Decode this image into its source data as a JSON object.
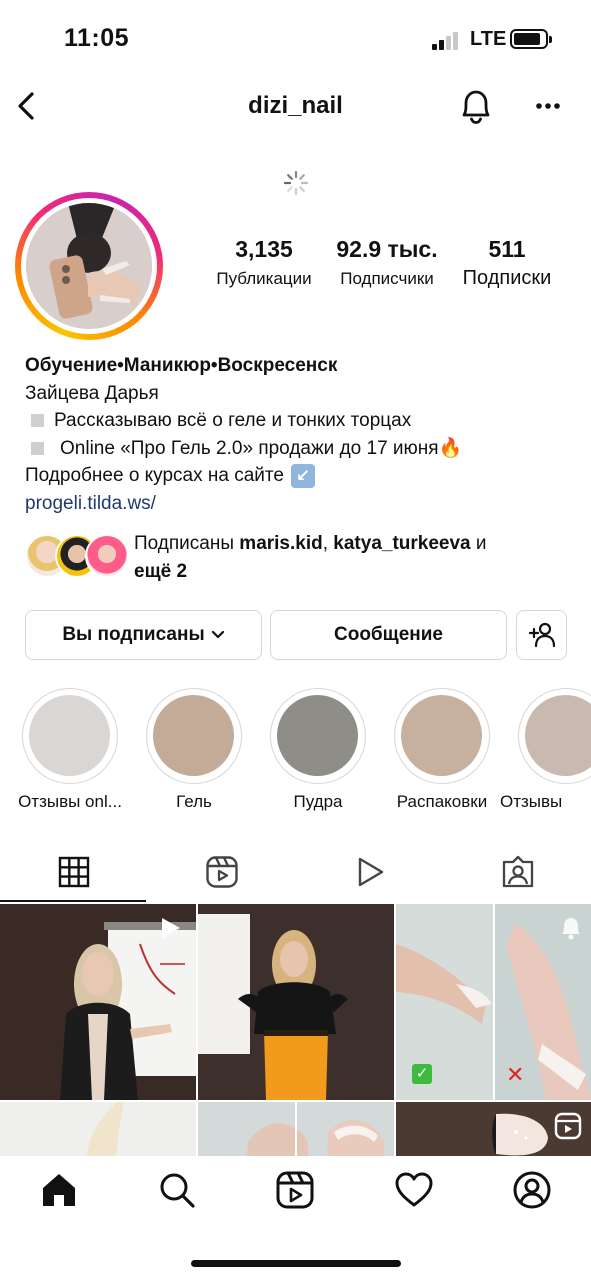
{
  "status_bar": {
    "time": "11:05",
    "network": "LTE",
    "signal_bars_active": 2,
    "signal_bars_total": 4
  },
  "header": {
    "username": "dizi_nail",
    "back_icon": "chevron-left-icon",
    "bell_icon": "bell-icon",
    "more_icon": "more-horizontal-icon"
  },
  "stats": {
    "posts": {
      "value": "3,135",
      "label": "Публикации"
    },
    "followers": {
      "value": "92.9 тыс.",
      "label": "Подписчики"
    },
    "following": {
      "value": "511",
      "label": "Подписки"
    }
  },
  "bio": {
    "name": "Обучение•Маникюр•Воскресенск",
    "line1": "Зайцева Дарья",
    "line2": "Рассказываю всё о геле и тонких торцах",
    "line3": "Online «Про Гель 2.0» продажи до 17 июня",
    "line3_emoji": "🔥",
    "line4": "Подробнее о курсах на сайте",
    "line4_emoji": "↙️",
    "link": "progeli.tilda.ws/"
  },
  "followed_by": {
    "prefix": "Подписаны ",
    "user1": "maris.kid",
    "sep": ", ",
    "user2": "katya_turkeeva",
    "and": " и ",
    "more": "ещё 2"
  },
  "buttons": {
    "following": "Вы подписаны",
    "message": "Сообщение",
    "add_icon": "add-person-icon"
  },
  "highlights": [
    {
      "label": "Отзывы onl...",
      "color": "#d9d6d4"
    },
    {
      "label": "Гель",
      "color": "#c3ab98"
    },
    {
      "label": "Пудра",
      "color": "#8f8d87"
    },
    {
      "label": "Распаковки",
      "color": "#c8b09e"
    },
    {
      "label": "Отзывы",
      "color": "#c8bab0"
    }
  ],
  "tabs": [
    {
      "name": "grid-icon",
      "active": true
    },
    {
      "name": "reels-icon",
      "active": false
    },
    {
      "name": "play-icon",
      "active": false
    },
    {
      "name": "tagged-icon",
      "active": false
    }
  ],
  "posts": [
    {
      "kind": "photo",
      "type_icon": "reel-play-icon"
    },
    {
      "kind": "photo",
      "type_icon": ""
    },
    {
      "kind": "photo",
      "type_icon": "carousel-icon",
      "marks": [
        "✅",
        "✖"
      ]
    },
    {
      "kind": "photo",
      "type_icon": ""
    },
    {
      "kind": "photo",
      "type_icon": ""
    },
    {
      "kind": "photo",
      "type_icon": "reels-icon"
    }
  ],
  "bottom_nav": [
    {
      "name": "home-icon"
    },
    {
      "name": "search-icon"
    },
    {
      "name": "reels-icon"
    },
    {
      "name": "heart-icon"
    },
    {
      "name": "profile-icon"
    }
  ]
}
